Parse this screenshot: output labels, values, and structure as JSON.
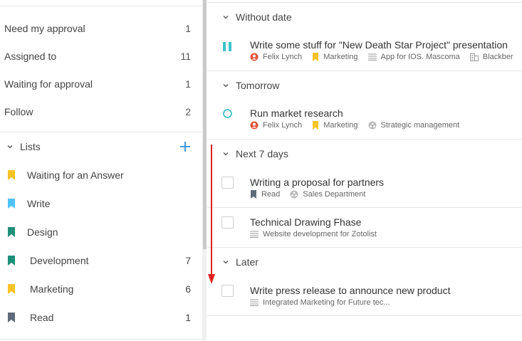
{
  "sidebar": {
    "filters": [
      {
        "label": "Need my approval",
        "count": "1"
      },
      {
        "label": "Assigned to",
        "count": "11"
      },
      {
        "label": "Waiting for approval",
        "count": "1"
      },
      {
        "label": "Follow",
        "count": "2"
      }
    ],
    "lists_header": "Lists",
    "lists": [
      {
        "label": "Waiting for an Answer",
        "count": "",
        "color": "#f7c325"
      },
      {
        "label": "Write",
        "count": "",
        "color": "#4fc3f7"
      },
      {
        "label": "Design",
        "count": "",
        "color": "#1f8f7a"
      },
      {
        "label": "Development",
        "count": "7",
        "color": "#1f8f7a"
      },
      {
        "label": "Marketing",
        "count": "6",
        "color": "#f7c325"
      },
      {
        "label": "Read",
        "count": "1",
        "color": "#5f6b7a"
      }
    ]
  },
  "groups": [
    {
      "label": "Without date"
    },
    {
      "label": "Tomorrow"
    },
    {
      "label": "Next 7 days"
    },
    {
      "label": "Later"
    }
  ],
  "tasks": [
    {
      "title": "Write some stuff for \"New Death Star Project\" presentation",
      "status": "paused",
      "meta": [
        "Felix Lynch",
        "Marketing",
        "App for IOS. Mascoma",
        "Blackber"
      ]
    },
    {
      "title": "Run market research",
      "status": "open",
      "meta": [
        "Felix Lynch",
        "Marketing",
        "Strategic management"
      ]
    },
    {
      "title": "Writing a proposal for partners",
      "status": "checkbox",
      "meta": [
        "Read",
        "Sales Department"
      ]
    },
    {
      "title": "Technical Drawing Fhase",
      "status": "checkbox",
      "meta": [
        "Website development for Zotolist"
      ]
    },
    {
      "title": "Write press release to announce new product",
      "status": "checkbox",
      "meta": [
        "Integrated Marketing for Future tec..."
      ]
    }
  ],
  "colors": {
    "accent": "#3ec1c9",
    "add_button": "#2f8fd8",
    "user_icon": "#e0523a",
    "arrow": "#e02020",
    "marketing_flag": "#f7c325",
    "read_flag": "#5f6b7a"
  }
}
